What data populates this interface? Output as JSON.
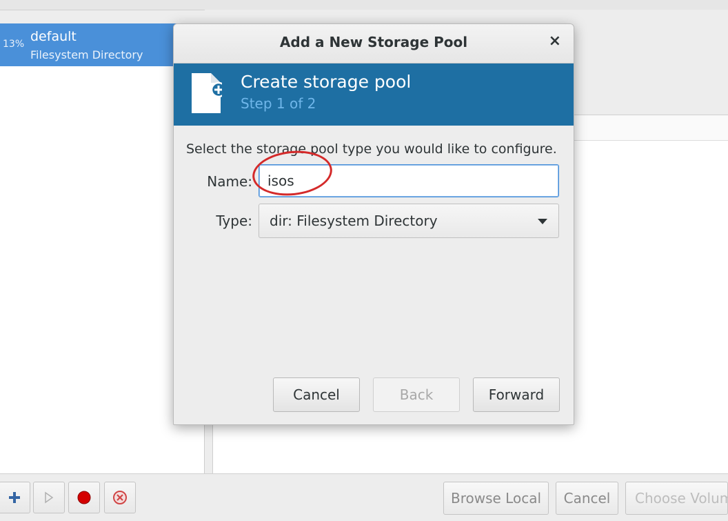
{
  "pools": [
    {
      "usage": "13%",
      "name": "default",
      "type": "Filesystem Directory"
    }
  ],
  "toolbar": {
    "icons": [
      "add-icon",
      "play-icon",
      "record-icon",
      "delete-icon"
    ]
  },
  "bottom_buttons": {
    "browse_local": "Browse Local",
    "cancel": "Cancel",
    "choose_volume": "Choose Volum"
  },
  "dialog": {
    "title": "Add a New Storage Pool",
    "close": "×",
    "banner_title": "Create storage pool",
    "banner_step": "Step 1 of 2",
    "instruction": "Select the storage pool type you would like to configure.",
    "name_label": "Name:",
    "name_value": "isos",
    "type_label": "Type:",
    "type_value": "dir: Filesystem Directory",
    "cancel": "Cancel",
    "back": "Back",
    "forward": "Forward"
  },
  "colors": {
    "selection": "#4a90d9",
    "banner": "#1e6fa3",
    "banner_step": "#6fb6ea",
    "annotation": "#d42a2a"
  }
}
